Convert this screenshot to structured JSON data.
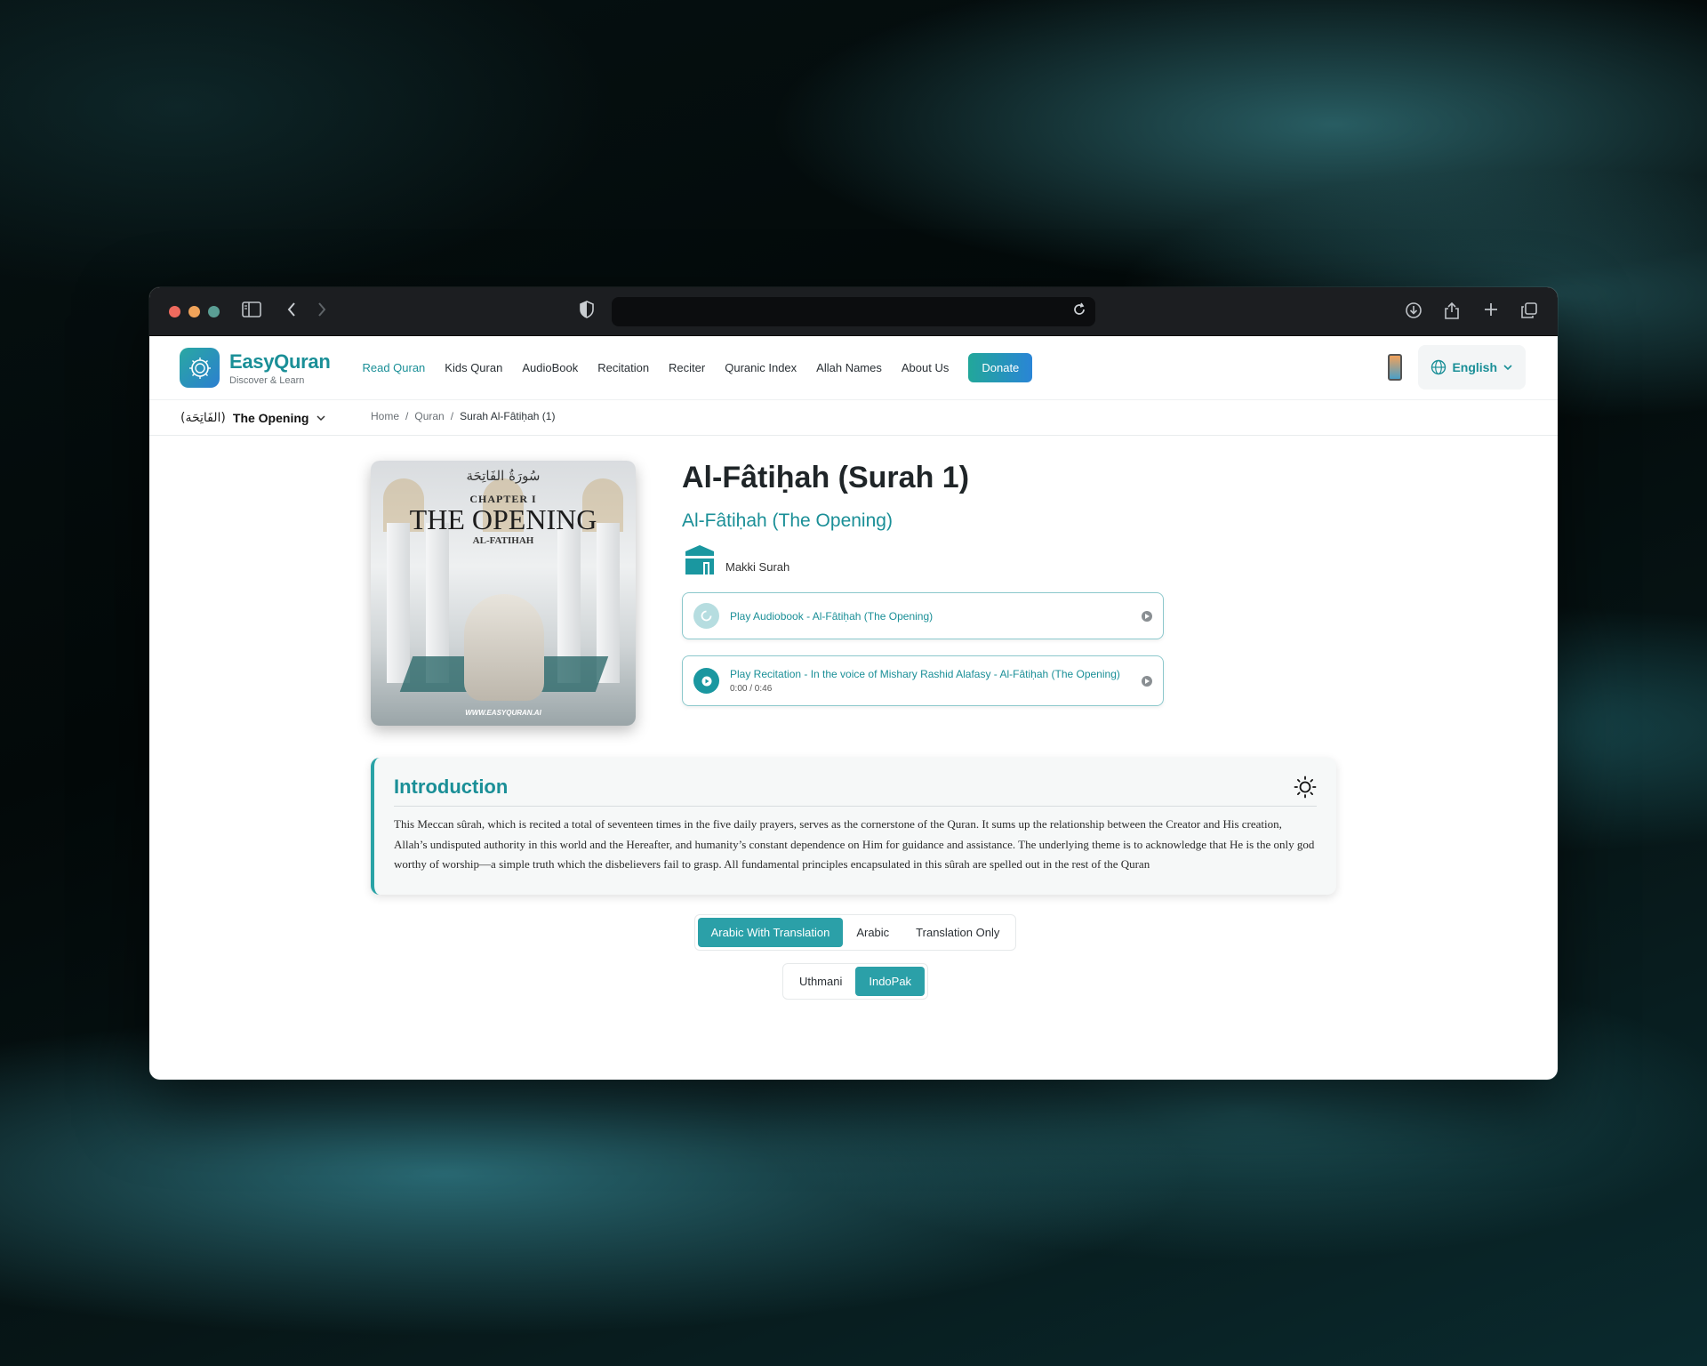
{
  "browser": {
    "url": ""
  },
  "header": {
    "brand_name": "EasyQuran",
    "brand_tagline": "Discover & Learn",
    "nav": [
      {
        "label": "Read Quran",
        "active": true
      },
      {
        "label": "Kids Quran"
      },
      {
        "label": "AudioBook"
      },
      {
        "label": "Recitation"
      },
      {
        "label": "Reciter"
      },
      {
        "label": "Quranic Index"
      },
      {
        "label": "Allah Names"
      },
      {
        "label": "About Us"
      }
    ],
    "donate_label": "Donate",
    "language": "English"
  },
  "surah_selector": {
    "arabic": "(الفَاتِحَة)",
    "english": "The Opening"
  },
  "breadcrumb": {
    "home": "Home",
    "quran": "Quran",
    "current": "Surah Al-Fâtiḥah (1)",
    "separator": "/"
  },
  "cover": {
    "arabic": "سُورَةُ الفَاتِحَة",
    "chapter": "CHAPTER I",
    "title": "THE OPENING",
    "subtitle": "AL-FATIHAH",
    "url": "WWW.EASYQURAN.AI"
  },
  "surah": {
    "title": "Al-Fâtiḥah (Surah 1)",
    "subtitle": "Al-Fâtiḥah (The Opening)",
    "type": "Makki Surah"
  },
  "players": {
    "audiobook_label": "Play Audiobook - Al-Fâtiḥah (The Opening)",
    "recitation_label": "Play Recitation - In the voice of Mishary Rashid Alafasy - Al-Fâtiḥah (The Opening)",
    "recitation_time": "0:00 / 0:46"
  },
  "intro": {
    "title": "Introduction",
    "text": "This Meccan sûrah, which is recited a total of seventeen times in the five daily prayers, serves as the cornerstone of the Quran. It sums up the relationship between the Creator and His creation, Allah’s undisputed authority in this world and the Hereafter, and humanity’s constant dependence on Him for guidance and assistance. The underlying theme is to acknowledge that He is the only god worthy of worship—a simple truth which the disbelievers fail to grasp. All fundamental principles encapsulated in this sûrah are spelled out in the rest of the Quran"
  },
  "view_tabs": {
    "items": [
      "Arabic With Translation",
      "Arabic",
      "Translation Only"
    ],
    "selected": "Arabic With Translation"
  },
  "script_tabs": {
    "items": [
      "Uthmani",
      "IndoPak"
    ],
    "selected": "IndoPak"
  },
  "colors": {
    "accent": "#1a8f97",
    "accent_fill": "#2ba0a8",
    "donate_gradient": [
      "#22a79a",
      "#2a85d6"
    ]
  }
}
